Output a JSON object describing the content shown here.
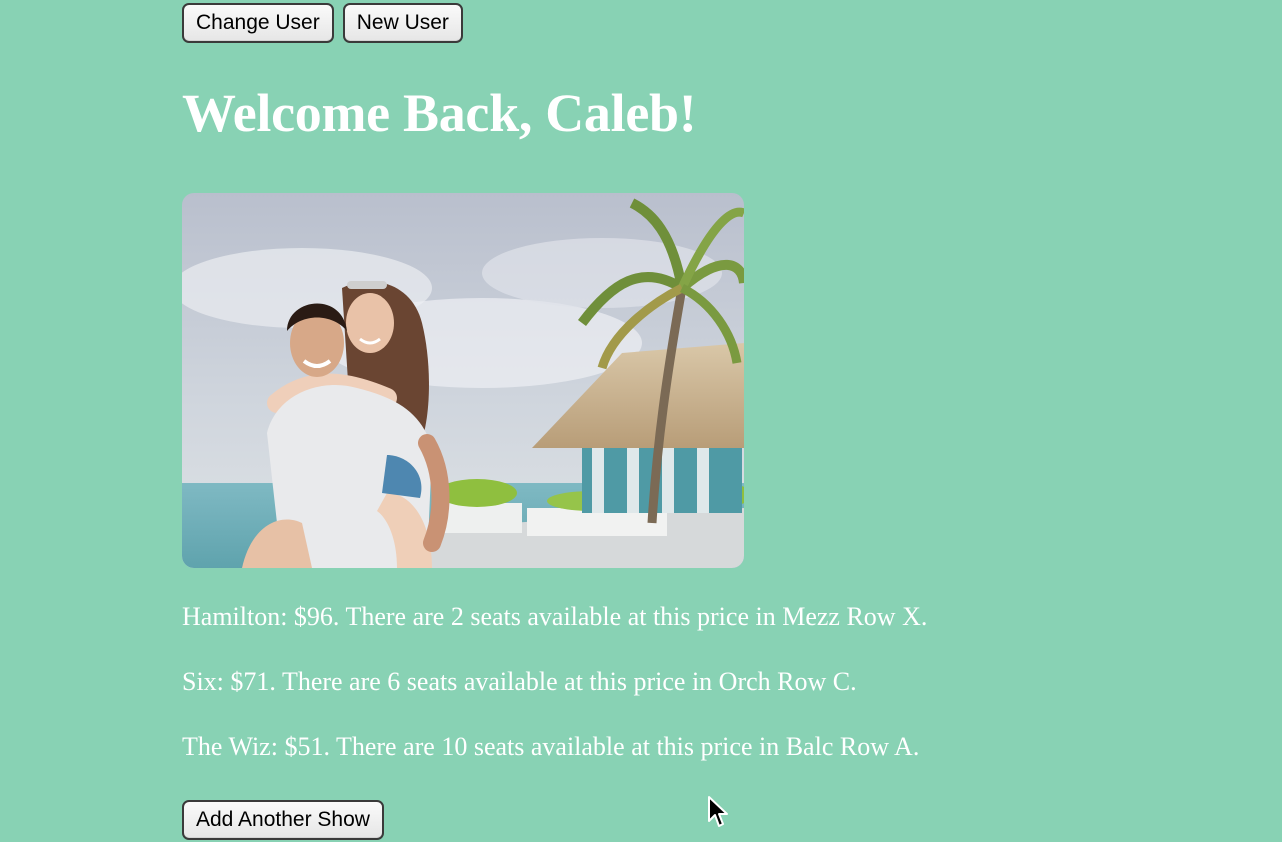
{
  "header": {
    "change_user_label": "Change User",
    "new_user_label": "New User"
  },
  "welcome": {
    "title": "Welcome Back, Caleb!"
  },
  "shows": [
    {
      "text": "Hamilton: $96. There are 2 seats available at this price in Mezz Row X."
    },
    {
      "text": "Six: $71. There are 6 seats available at this price in Orch Row C."
    },
    {
      "text": "The Wiz: $51. There are 10 seats available at this price in Balc Row A."
    }
  ],
  "actions": {
    "add_show_label": "Add Another Show"
  },
  "colors": {
    "background": "#88d2b4",
    "text": "#ffffff"
  },
  "icons": {
    "cursor": "mouse-pointer-icon"
  }
}
